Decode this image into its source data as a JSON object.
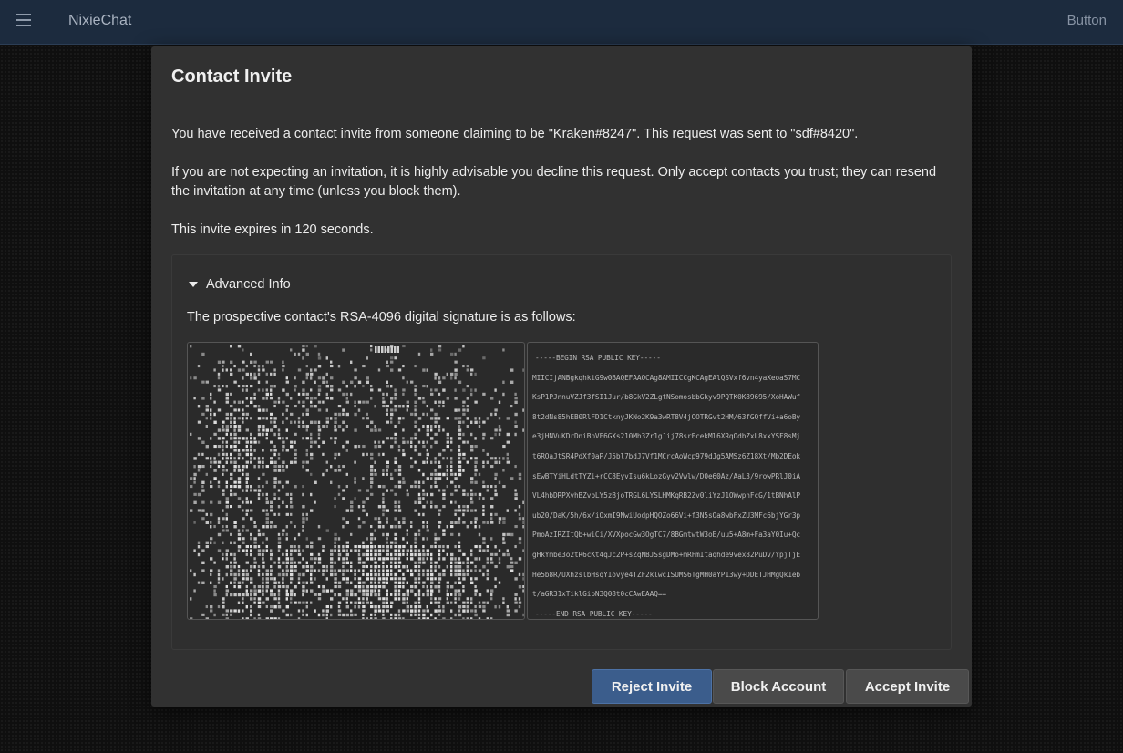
{
  "topbar": {
    "menu_icon": "hamburger-menu-icon",
    "app_title": "NixieChat",
    "button_label": "Button"
  },
  "modal": {
    "title": "Contact Invite",
    "paragraphs": [
      "You have received a contact invite from someone claiming to be \"Kraken#8247\". This request was sent to \"sdf#8420\".",
      "If you are not expecting an invitation, it is highly advisable you decline this request. Only accept contacts you trust; they can resend the invitation at any time (unless you block them).",
      "This invite expires in 120 seconds."
    ],
    "advanced": {
      "summary": "Advanced Info",
      "description": "The prospective contact's RSA-4096 digital signature is as follows:",
      "public_key_lines": [
        "-----BEGIN RSA PUBLIC KEY-----",
        "MIICIjANBgkqhkiG9w0BAQEFAAOCAg8AMIICCgKCAgEAlQSVxf6vn4yaXeoaS7MC",
        "KsP1PJnnuVZJf3fSI1Jur/b8GkV2ZLgtNSomosbbGkyv9PQTK0K89695/XoHAWuf",
        "8t2dNs85hEB0RlFD1CtknyJKNo2K9a3wRT8V4jOOTRGvt2HM/63fGQffVi+a6oBy",
        "e3jHNVuKDrDniBpVF6GXs210Mh3Zr1gJij78srEcekMl6XRqOdbZxL8xxYSF8sMj",
        "t6ROaJtSR4PdXf0aP/J5bl7bdJ7Vf1MCrcAoWcp979dJg5AMSz6Z18Xt/Mb2DEok",
        "sEwBTYiHLdtTYZi+rCC8EyvIsu6kLozGyv2Vwlw/D0e60Az/AaL3/9rowPRlJ0iA",
        "VL4hbDRPXvhBZvbLY5zBjoTRGL6LYSLHMKqRB2Zv0liYzJ1OWwphFcG/1tBNhAlP",
        "ub20/DaK/5h/6x/iOxmI9NwiUodpHQOZo66Vi+f3N5sOa8wbFxZU3MFc6bjYGr3p",
        "PmoAzIRZItQb+wiCi/XVXpocGw3OgTC7/8BGmtwtW3oE/uu5+A8m+Fa3aY0Iu+Qc",
        "gHkYmbe3o2tR6cKt4qJc2P+sZqNBJSsgDMo+mRFmItaqhde9vex82PuDv/YpjTjE",
        "He5b8R/UXhzslbHsqYIovye4TZF2klwc1SUMS6TgMH0aYP13wy+DDETJHMgQk1eb",
        "t/aGR31xTiklGipN3Q08t0cCAwEAAQ==",
        "-----END RSA PUBLIC KEY-----"
      ]
    },
    "buttons": {
      "reject": "Reject Invite",
      "block": "Block Account",
      "accept": "Accept Invite"
    }
  },
  "colors": {
    "topbar_bg": "#1c2b3e",
    "modal_bg": "#313131",
    "primary_button": "#3b5d8c",
    "secondary_button": "#4a4a4a"
  }
}
